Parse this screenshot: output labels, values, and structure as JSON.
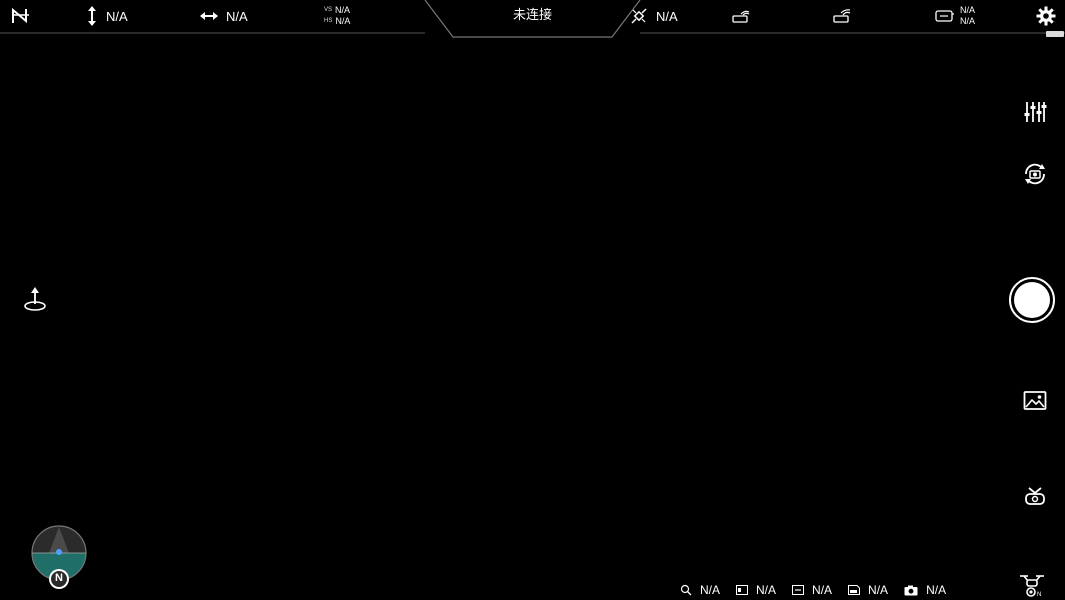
{
  "topbar": {
    "altitude_value": "N/A",
    "distance_value": "N/A",
    "vertical_speed_value": "N/A",
    "horizontal_speed_value": "N/A",
    "vertical_speed_tag": "VS",
    "horizontal_speed_tag": "HS",
    "connection_status": "未连接",
    "gps_value": "N/A",
    "remote_battery_top": "N/A",
    "remote_battery_bottom": "N/A"
  },
  "bottom": {
    "zoom_value": "N/A",
    "iso_value": "N/A",
    "shutter_value": "N/A",
    "storage_value": "N/A",
    "camera_value": "N/A"
  },
  "radar": {
    "north_label": "N"
  },
  "colors": {
    "background": "#000000",
    "radar_ground": "#1f6e68",
    "radar_sky": "#2b2b2b",
    "accent_blue": "#4aa3ff"
  }
}
